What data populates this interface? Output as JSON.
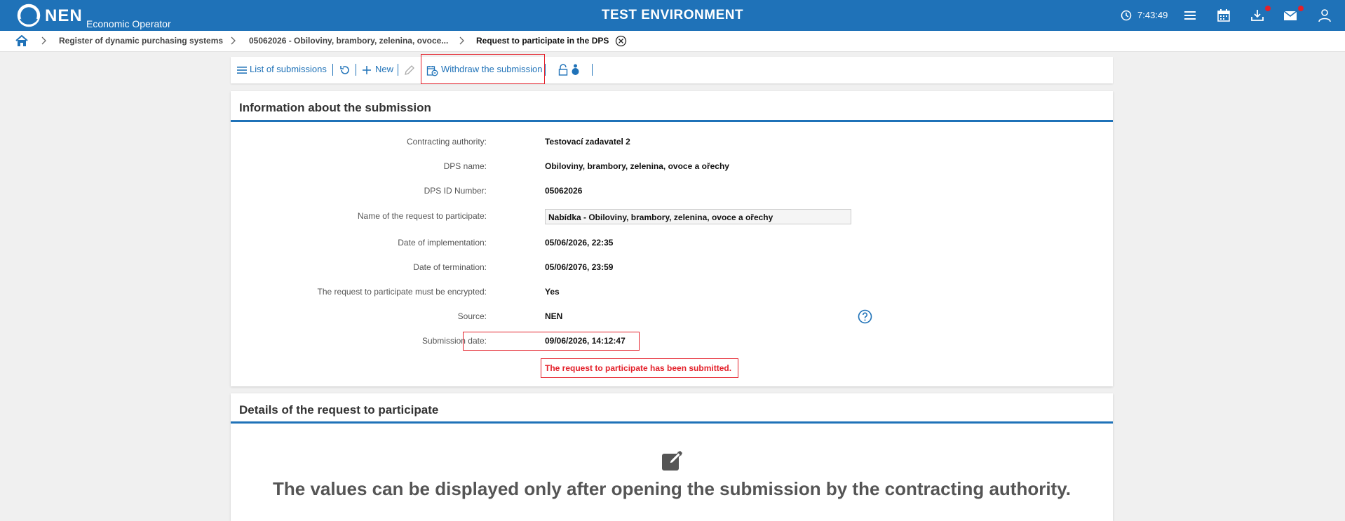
{
  "header": {
    "brand": "NEN",
    "brand_sub": "Economic Operator",
    "environment": "TEST ENVIRONMENT",
    "clock": "7:43:49",
    "colors": {
      "bar": "#1f72b8",
      "notification_dot": "#e4202a"
    },
    "icons": [
      "clock-icon",
      "menu-icon",
      "calendar-icon",
      "download-icon",
      "mail-icon",
      "user-icon"
    ]
  },
  "breadcrumb": {
    "items": [
      "Register of dynamic purchasing systems",
      "05062026 - Obiloviny, brambory, zelenina, ovoce...",
      "Request to participate in the DPS"
    ]
  },
  "toolbar": {
    "list": "List of submissions",
    "new": "New",
    "withdraw": "Withdraw the submission"
  },
  "info": {
    "title": "Information about the submission",
    "rows": [
      {
        "label": "Contracting authority:",
        "value": "Testovací zadavatel 2"
      },
      {
        "label": "DPS name:",
        "value": "Obiloviny, brambory, zelenina, ovoce a ořechy"
      },
      {
        "label": "DPS ID Number:",
        "value": "05062026"
      },
      {
        "label": "Name of the request to participate:",
        "value": "Nabídka - Obiloviny, brambory, zelenina, ovoce a ořechy"
      },
      {
        "label": "Date of implementation:",
        "value": "05/06/2026, 22:35"
      },
      {
        "label": "Date of termination:",
        "value": "05/06/2076, 23:59"
      },
      {
        "label": "The request to participate must be encrypted:",
        "value": "Yes"
      },
      {
        "label": "Source:",
        "value": "NEN"
      },
      {
        "label": "Submission date:",
        "value": "09/06/2026, 14:12:47"
      }
    ],
    "status": "The request to participate has been submitted."
  },
  "details": {
    "title": "Details of the request to participate",
    "message": "The values can be displayed only after opening the submission by the contracting authority."
  }
}
